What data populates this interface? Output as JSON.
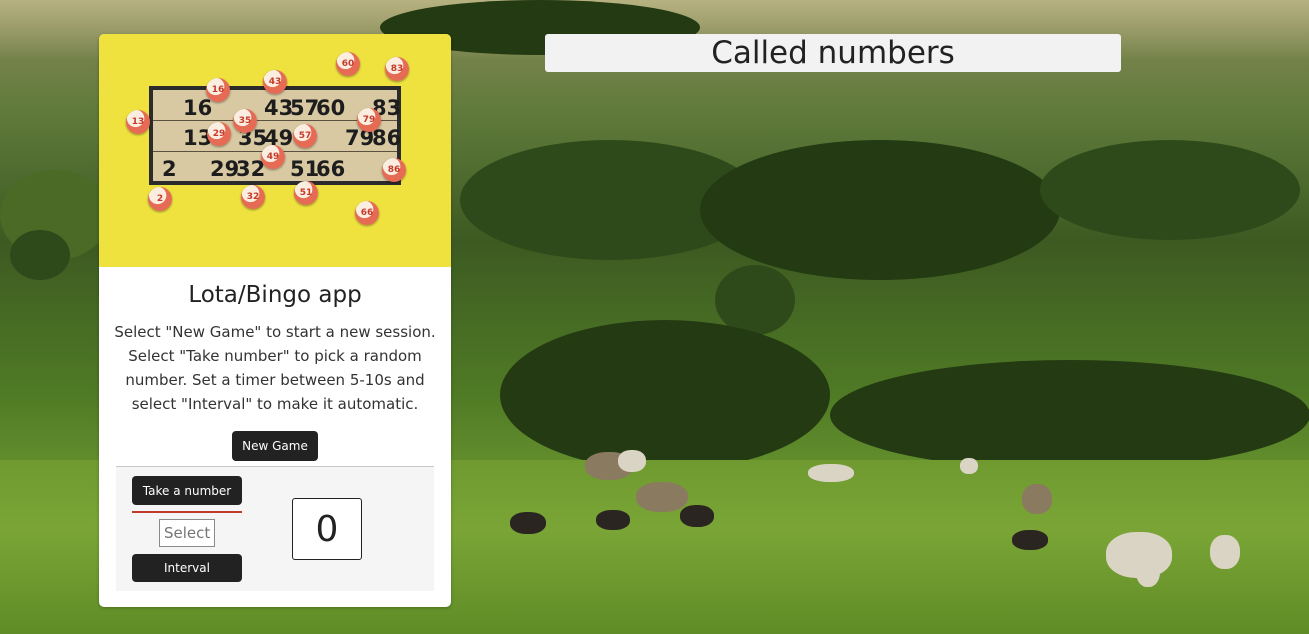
{
  "app": {
    "title": "Lota/Bingo app",
    "description": "Select \"New Game\" to start a new session. Select \"Take number\" to pick a random number. Set a timer between 5-10s and select \"Interval\" to make it automatic."
  },
  "buttons": {
    "new_game": "New Game",
    "take_number": "Take a number",
    "interval": "Interval"
  },
  "interval_input": {
    "placeholder": "Select"
  },
  "current_number": "0",
  "called_numbers": {
    "heading": "Called numbers"
  },
  "bingo_card_image": {
    "board_numbers": [
      "16",
      "43",
      "57",
      "60",
      "83",
      "13",
      "35",
      "49",
      "79",
      "86",
      "2",
      "29",
      "32",
      "51",
      "66"
    ],
    "ball_numbers": [
      "60",
      "83",
      "16",
      "43",
      "13",
      "29",
      "35",
      "57",
      "79",
      "49",
      "86",
      "2",
      "32",
      "51",
      "66"
    ]
  },
  "colors": {
    "button_bg": "#222222",
    "button_text": "#ffffff",
    "accent_line": "#c0392b",
    "image_bg": "#efe23f"
  }
}
